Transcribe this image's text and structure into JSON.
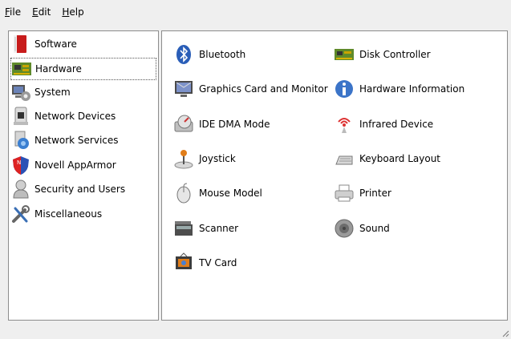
{
  "menubar": {
    "file": {
      "accel": "F",
      "rest": "ile"
    },
    "edit": {
      "accel": "E",
      "rest": "dit"
    },
    "help": {
      "accel": "H",
      "rest": "elp"
    }
  },
  "sidebar": {
    "selected": "Hardware",
    "items": [
      {
        "label": "Software",
        "icon": "software-icon"
      },
      {
        "label": "Hardware",
        "icon": "hardware-icon"
      },
      {
        "label": "System",
        "icon": "system-icon"
      },
      {
        "label": "Network Devices",
        "icon": "network-devices-icon"
      },
      {
        "label": "Network Services",
        "icon": "network-services-icon"
      },
      {
        "label": "Novell AppArmor",
        "icon": "apparmor-icon"
      },
      {
        "label": "Security and Users",
        "icon": "security-icon"
      },
      {
        "label": "Miscellaneous",
        "icon": "miscellaneous-icon"
      }
    ]
  },
  "modules": {
    "left": [
      {
        "label": "Bluetooth",
        "icon": "bluetooth-icon"
      },
      {
        "label": "Graphics Card and Monitor",
        "icon": "monitor-icon"
      },
      {
        "label": "IDE DMA Mode",
        "icon": "ide-dma-icon"
      },
      {
        "label": "Joystick",
        "icon": "joystick-icon"
      },
      {
        "label": "Mouse Model",
        "icon": "mouse-icon"
      },
      {
        "label": "Scanner",
        "icon": "scanner-icon"
      },
      {
        "label": "TV Card",
        "icon": "tv-card-icon"
      }
    ],
    "right": [
      {
        "label": "Disk Controller",
        "icon": "disk-controller-icon"
      },
      {
        "label": "Hardware Information",
        "icon": "info-icon"
      },
      {
        "label": "Infrared Device",
        "icon": "infrared-icon"
      },
      {
        "label": "Keyboard Layout",
        "icon": "keyboard-icon"
      },
      {
        "label": "Printer",
        "icon": "printer-icon"
      },
      {
        "label": "Sound",
        "icon": "sound-icon"
      }
    ]
  },
  "colors": {
    "background": "#efefef",
    "panel": "#ffffff",
    "border": "#8c8c8c"
  }
}
